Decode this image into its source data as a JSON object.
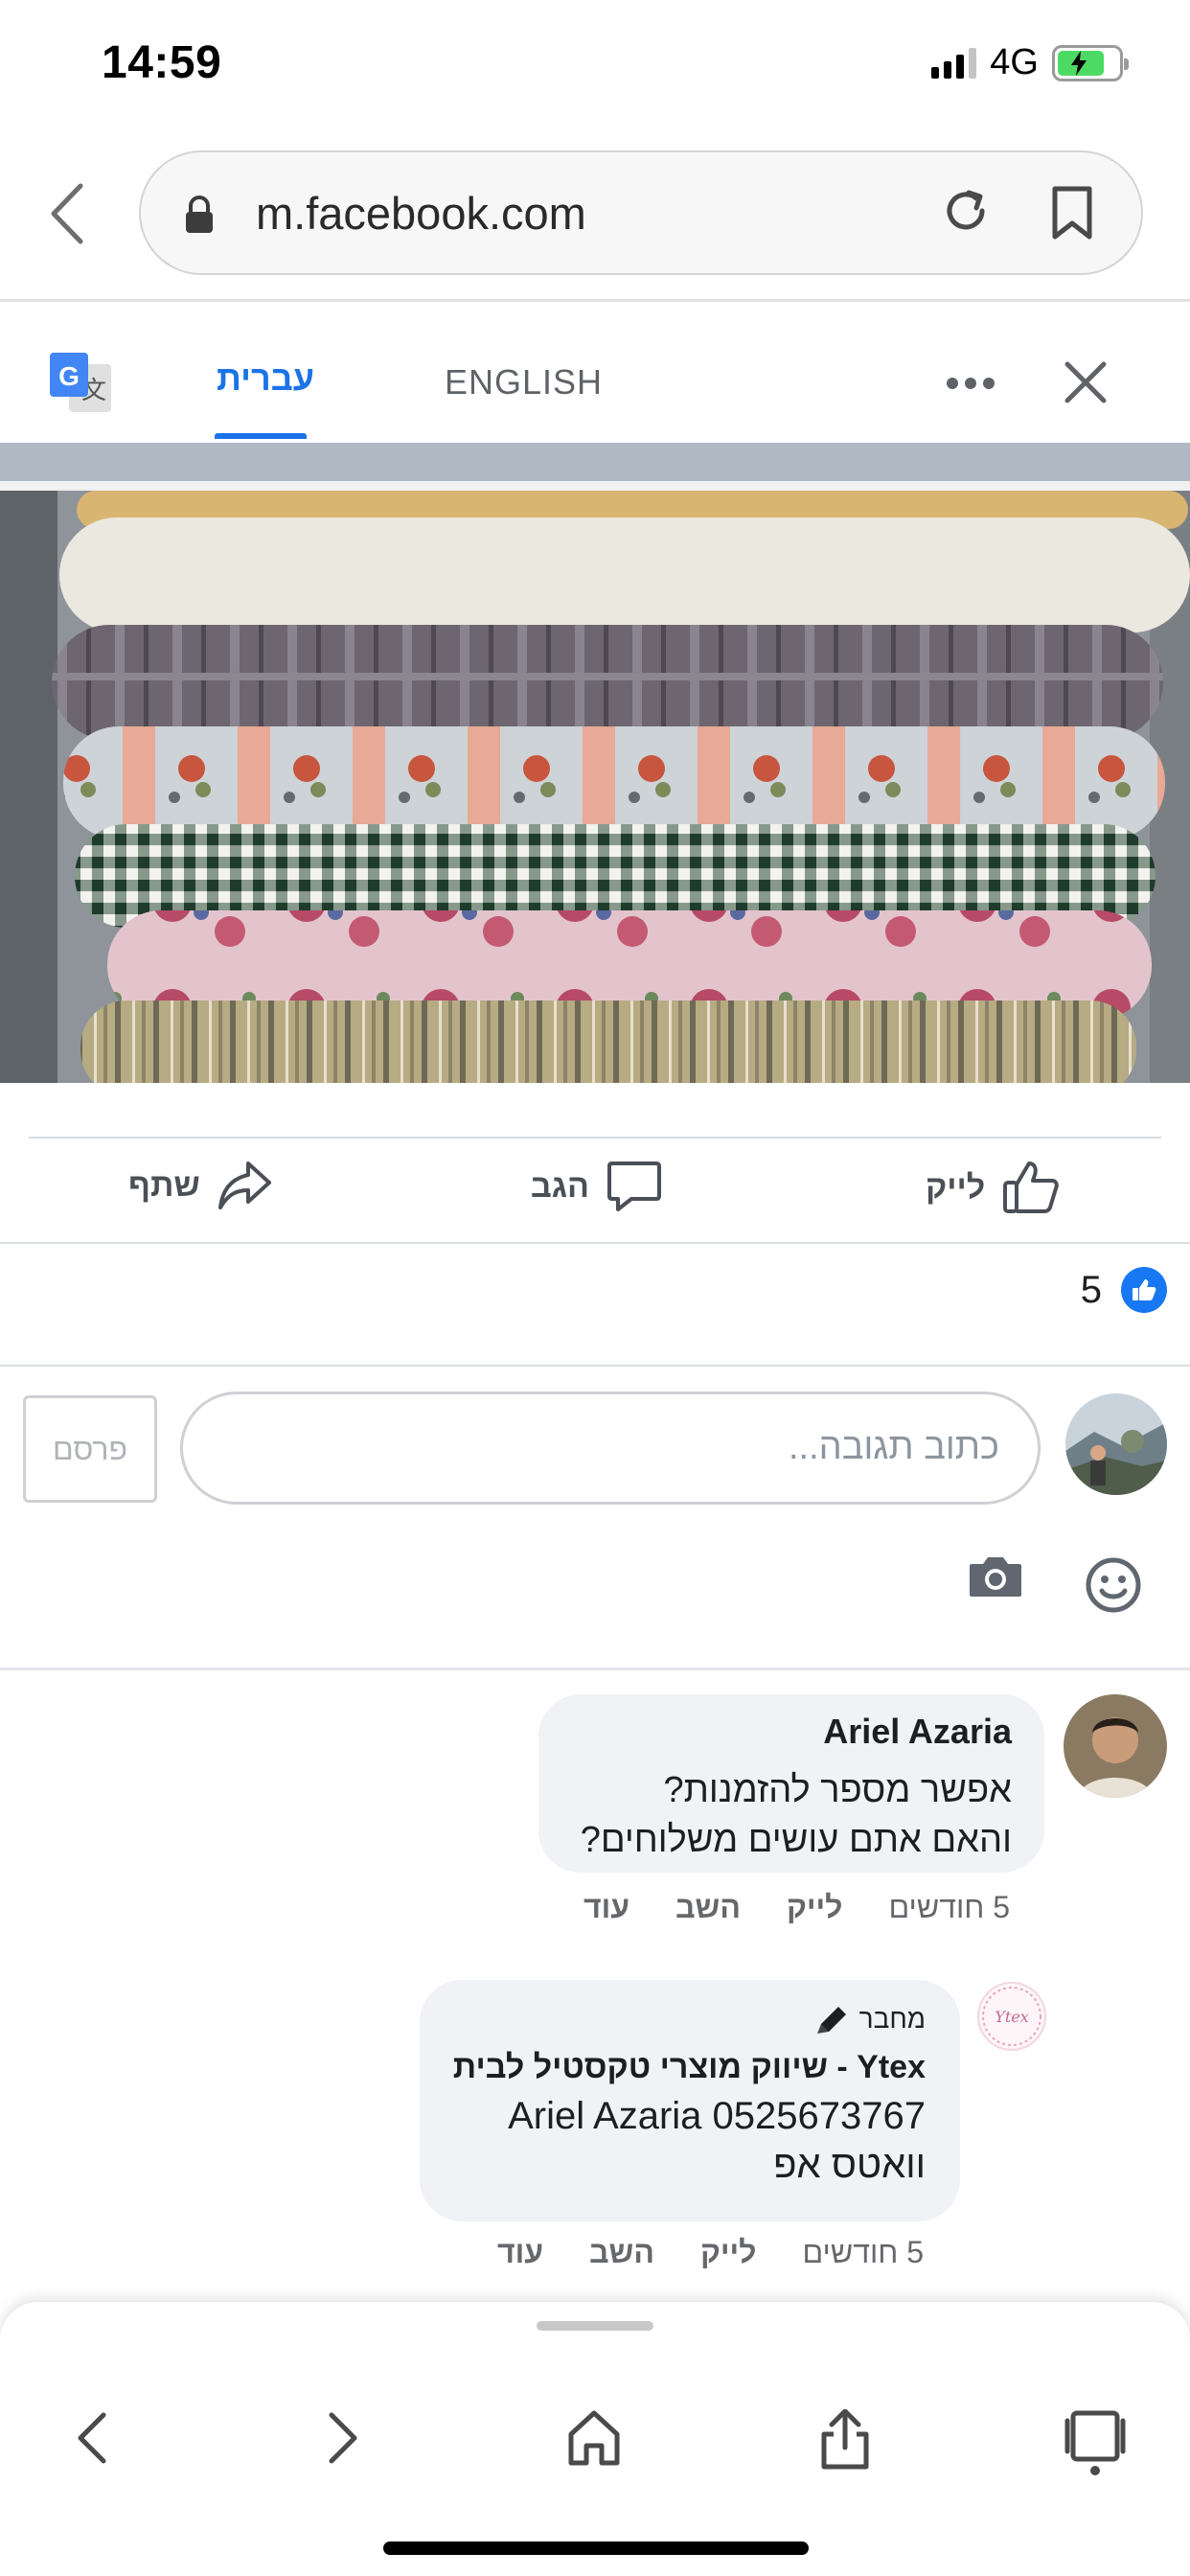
{
  "status_bar": {
    "time": "14:59",
    "network": "4G",
    "battery_charging": true
  },
  "browser": {
    "url": "m.facebook.com",
    "icons": [
      "back-icon",
      "lock-icon",
      "reload-icon",
      "bookmark-icon"
    ]
  },
  "translate_bar": {
    "tabs": [
      {
        "label": "עברית",
        "active": true
      },
      {
        "label": "ENGLISH",
        "active": false
      }
    ],
    "accent_color": "#1a73e8"
  },
  "post_actions": {
    "like_label": "לייק",
    "comment_label": "הגב",
    "share_label": "שתף"
  },
  "reactions": {
    "count": "5"
  },
  "composer": {
    "placeholder": "כתוב תגובה...",
    "post_label": "פרסם"
  },
  "comments": [
    {
      "name": "Ariel Azaria",
      "lines": [
        "אפשר מספר להזמנות?",
        "והאם אתם עושים משלוחים?"
      ],
      "time": "5 חודשים",
      "like": "לייק",
      "reply": "השב",
      "more": "עוד"
    },
    {
      "badge": "מחבר",
      "name": "Ytex - שיווק מוצרי טקסטיל לבית",
      "lines": [
        "Ariel Azaria 0525673767",
        "וואטס אפ"
      ],
      "time": "5 חודשים",
      "like": "לייק",
      "reply": "השב",
      "more": "עוד"
    }
  ],
  "colors": {
    "facebook_blue": "#1877f2",
    "bubble_bg": "#f0f2f5",
    "meta_text": "#65676b"
  }
}
